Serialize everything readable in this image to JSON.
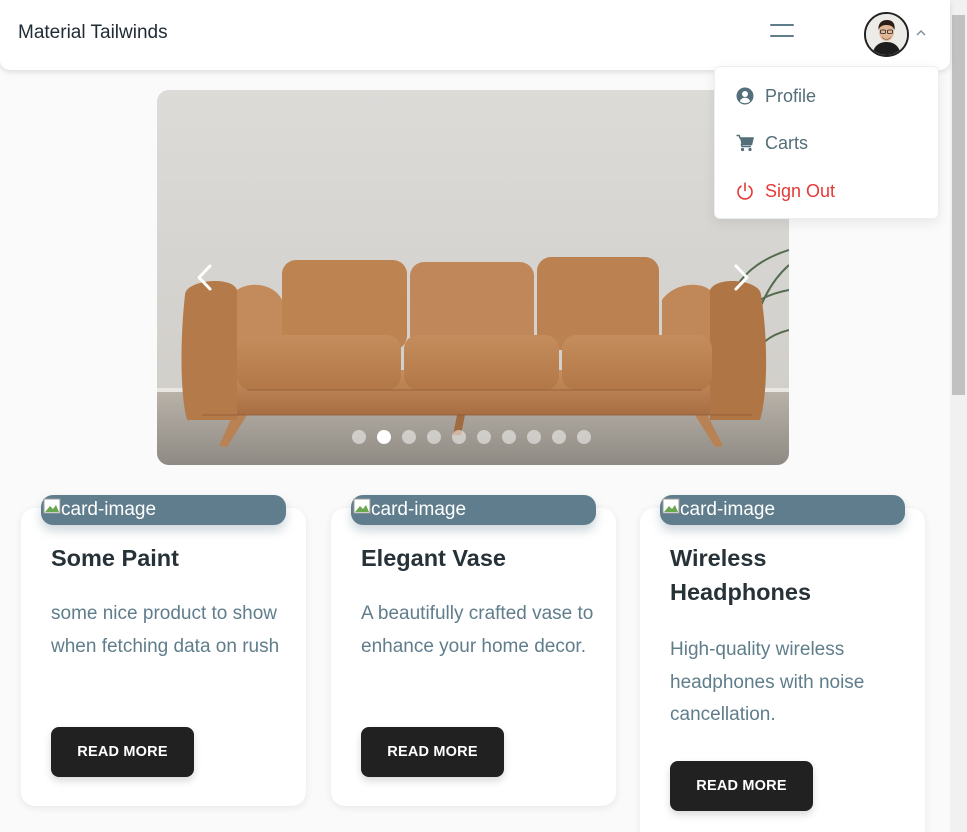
{
  "navbar": {
    "brand": "Material Tailwinds",
    "menu_icon": "hamburger-icon",
    "avatar_icon": "avatar",
    "chevron_icon": "chevron-up-icon"
  },
  "dropdown": {
    "items": [
      {
        "label": "Profile",
        "icon": "user-circle-icon",
        "color": "#546e7a"
      },
      {
        "label": "Carts",
        "icon": "cart-icon",
        "color": "#546e7a"
      },
      {
        "label": "Sign Out",
        "icon": "power-icon",
        "color": "#e53935"
      }
    ]
  },
  "carousel": {
    "slide_count": 10,
    "active_index": 1,
    "prev_icon": "chevron-left-icon",
    "next_icon": "chevron-right-icon"
  },
  "cards": [
    {
      "image_alt": "card-image",
      "title": "Some Paint",
      "description": "some nice product to show when fetching data on rush",
      "button": "READ MORE"
    },
    {
      "image_alt": "card-image",
      "title": "Elegant Vase",
      "description": "A beautifully crafted vase to enhance your home decor.",
      "button": "READ MORE"
    },
    {
      "image_alt": "card-image",
      "title": "Wireless Headphones",
      "description": "High-quality wireless headphones with noise cancellation.",
      "button": "READ MORE"
    }
  ],
  "colors": {
    "image_placeholder": "#5f7d8c",
    "button_bg": "#212121",
    "danger": "#e53935",
    "muted_text": "#607d8b"
  }
}
